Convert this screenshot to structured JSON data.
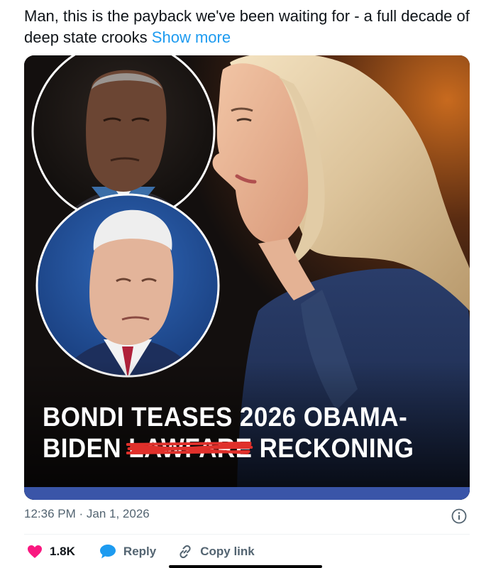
{
  "post": {
    "text": "Man, this is the payback we've been waiting for - a full decade of deep state crooks",
    "show_more": "Show more"
  },
  "media": {
    "headline_line1": "BONDI TEASES 2026 OBAMA-",
    "headline_line2_start": "BIDEN ",
    "headline_line2_struck": "LAWFARE",
    "headline_line2_end": " RECKONING"
  },
  "meta": {
    "timestamp": "12:36 PM · Jan 1, 2026"
  },
  "actions": {
    "like_count": "1.8K",
    "reply_label": "Reply",
    "copy_label": "Copy link"
  },
  "colors": {
    "accent": "#1d9bf0",
    "like": "#f91880",
    "reply": "#1d9bf0",
    "media_bar": "#3a55a8",
    "scribble": "#e0302b"
  },
  "icons": [
    "heart-icon",
    "reply-bubble-icon",
    "link-icon",
    "info-icon"
  ]
}
